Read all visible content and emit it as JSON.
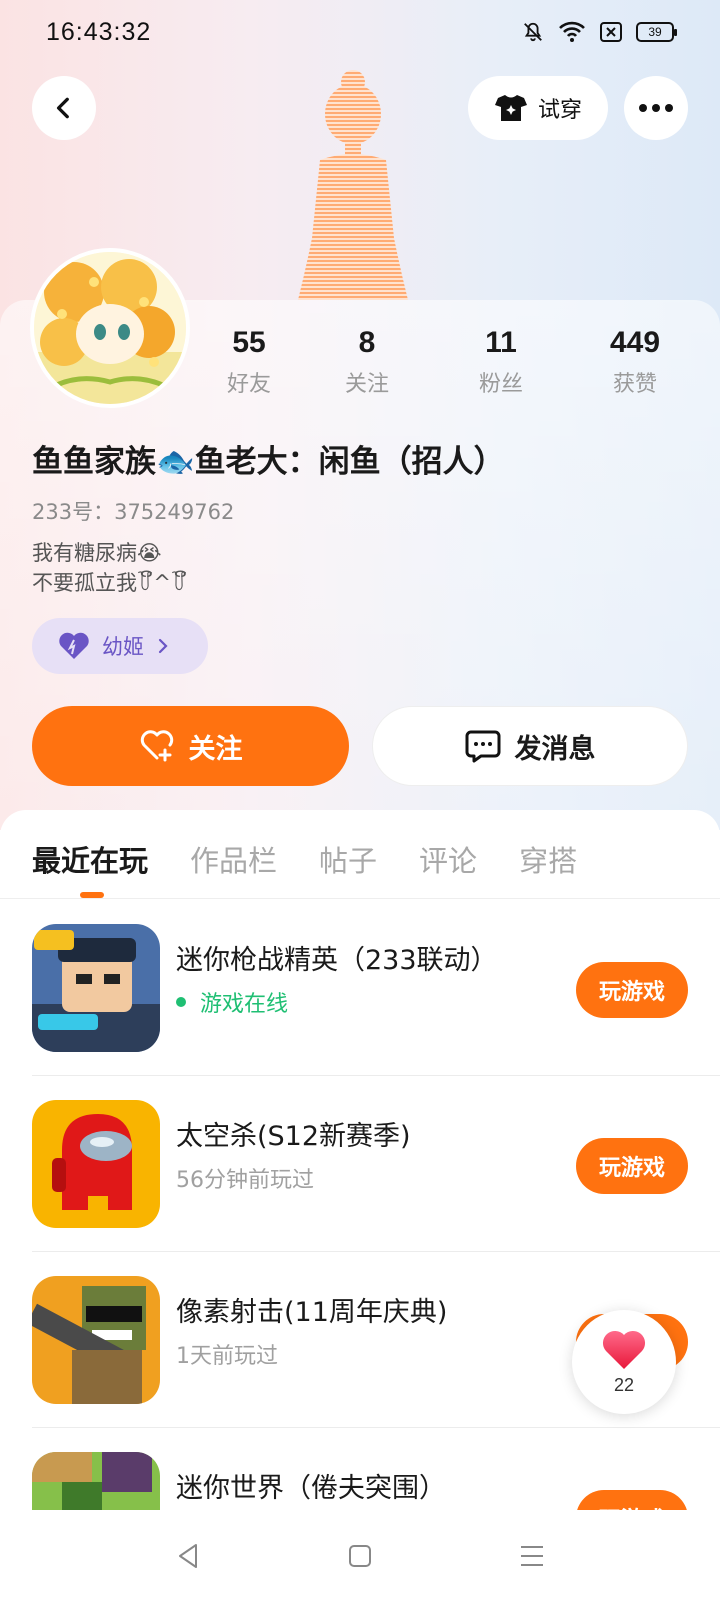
{
  "status_bar": {
    "time": "16:43:32",
    "battery": "39"
  },
  "header": {
    "tryon_label": "试穿"
  },
  "stats": [
    {
      "value": "55",
      "label": "好友"
    },
    {
      "value": "8",
      "label": "关注"
    },
    {
      "value": "11",
      "label": "粉丝"
    },
    {
      "value": "449",
      "label": "获赞"
    }
  ],
  "profile": {
    "nickname": "鱼鱼家族🐟鱼老大：闲鱼（招人）",
    "uid": "233号：375249762",
    "bio_line1": "我有糖尿病😭",
    "bio_line2": "不要孤立我꒦ິ^꒦ິ",
    "badge_label": "幼姬"
  },
  "actions": {
    "follow_label": "关注",
    "message_label": "发消息"
  },
  "tabs": [
    {
      "label": "最近在玩",
      "active": true
    },
    {
      "label": "作品栏"
    },
    {
      "label": "帖子"
    },
    {
      "label": "评论"
    },
    {
      "label": "穿搭"
    }
  ],
  "games": [
    {
      "title": "迷你枪战精英（233联动）",
      "status": "游戏在线",
      "online": true,
      "button": "玩游戏"
    },
    {
      "title": "太空杀(S12新赛季)",
      "status": "56分钟前玩过",
      "button": "玩游戏"
    },
    {
      "title": "像素射击(11周年庆典)",
      "status": "1天前玩过",
      "button": "玩游戏"
    },
    {
      "title": "迷你世界（倦夫突围）",
      "status": "",
      "button": "玩游戏"
    }
  ],
  "like_float": {
    "count": "22"
  },
  "colors": {
    "accent": "#ff7210",
    "online": "#1fbf73",
    "badge_bg": "#e7e0f6",
    "badge_text": "#6a55c5"
  }
}
